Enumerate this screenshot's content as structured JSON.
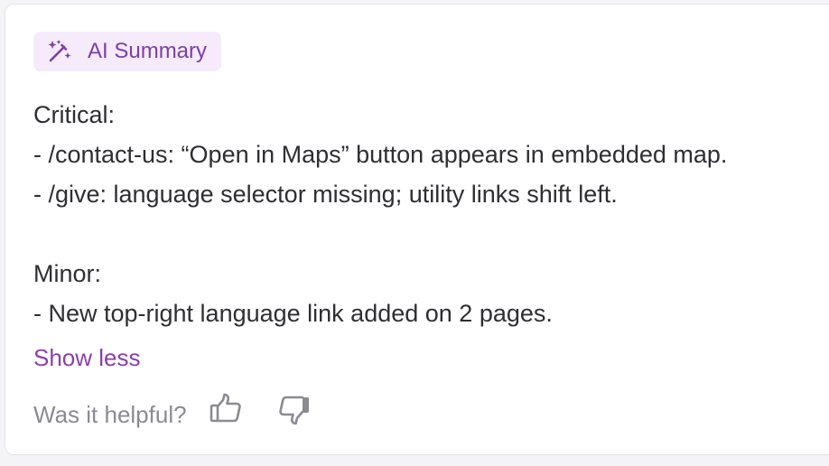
{
  "badge": {
    "icon": "magic-wand-sparkle-icon",
    "label": "AI Summary",
    "color": "#7b3fa6",
    "background": "#f5ebfb"
  },
  "summary": {
    "lines": [
      "Critical:",
      "- /contact-us: “Open in Maps” button appears in embedded map.",
      "- /give: language selector missing; utility links shift left.",
      "",
      "Minor:",
      "- New top-right language link added on 2 pages."
    ]
  },
  "toggle": {
    "label": "Show less",
    "color": "#8a3fae"
  },
  "feedback": {
    "question": "Was it helpful?",
    "thumbs_up_icon": "thumbs-up-icon",
    "thumbs_down_icon": "thumbs-down-icon"
  }
}
